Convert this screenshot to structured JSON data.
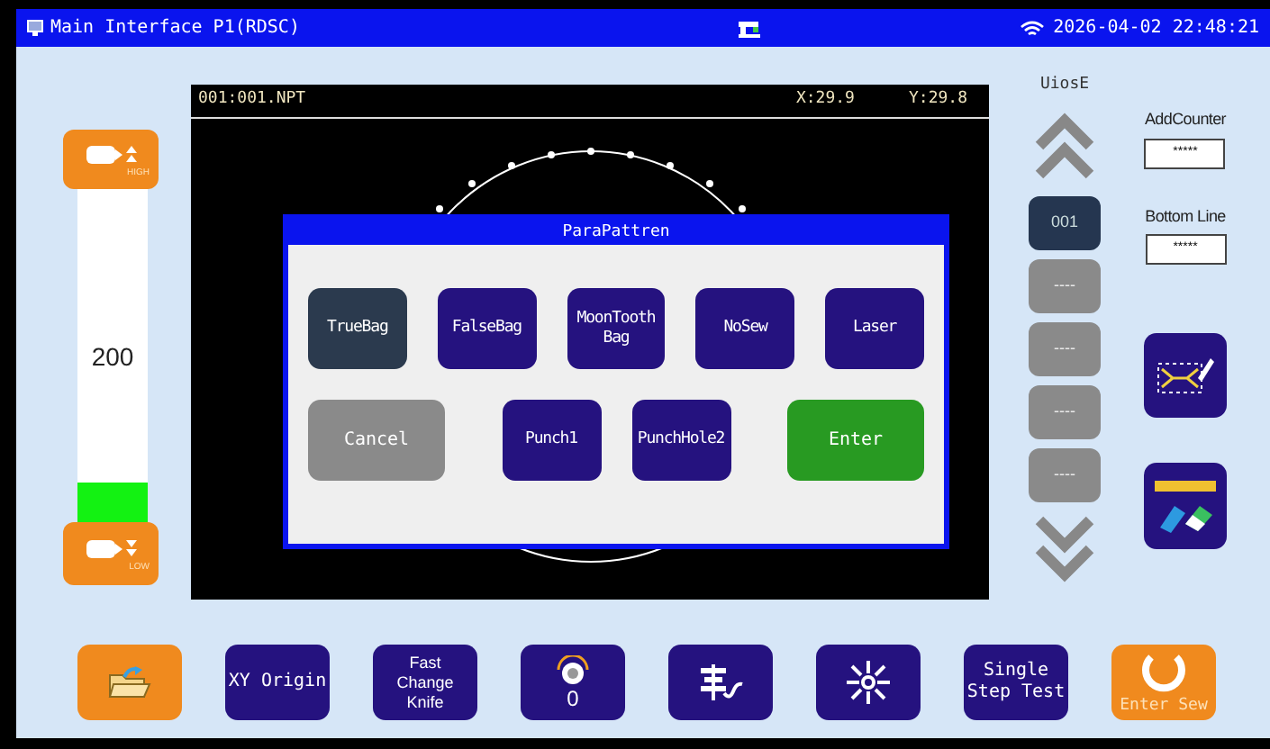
{
  "window": {
    "title": "Main Interface P1(RDSC)",
    "datetime": "2026-04-02 22:48:21"
  },
  "speed": {
    "high_label": "HIGH",
    "low_label": "LOW",
    "value": "200",
    "level": 0.12
  },
  "canvas": {
    "file": "001:001.NPT",
    "x": "X:29.9",
    "y": "Y:29.8"
  },
  "dialog": {
    "title": "ParaPattren",
    "patterns": [
      {
        "label": "TrueBag",
        "selected": true
      },
      {
        "label": "FalseBag",
        "selected": false
      },
      {
        "label": "MoonTooth Bag",
        "selected": false
      },
      {
        "label": "NoSew",
        "selected": false
      },
      {
        "label": "Laser",
        "selected": false
      },
      {
        "label": "Punch1",
        "selected": false
      },
      {
        "label": "PunchHole2",
        "selected": false
      }
    ],
    "cancel": "Cancel",
    "enter": "Enter"
  },
  "pattern_list": {
    "title": "UiosE",
    "items": [
      {
        "label": "001",
        "selected": true
      },
      {
        "label": "----",
        "selected": false
      },
      {
        "label": "----",
        "selected": false
      },
      {
        "label": "----",
        "selected": false
      },
      {
        "label": "----",
        "selected": false
      }
    ]
  },
  "counters": [
    {
      "label": "AddCounter",
      "value": "*****"
    },
    {
      "label": "Bottom Line",
      "value": "*****"
    }
  ],
  "toolbar": [
    {
      "kind": "folder"
    },
    {
      "kind": "text",
      "label": "XY Origin"
    },
    {
      "kind": "small_text",
      "label": "Fast Change Knife"
    },
    {
      "kind": "knob",
      "label": "0"
    },
    {
      "kind": "thread"
    },
    {
      "kind": "center"
    },
    {
      "kind": "text",
      "label": "Single Step Test"
    },
    {
      "kind": "enter_sew",
      "label": "Enter Sew"
    }
  ]
}
